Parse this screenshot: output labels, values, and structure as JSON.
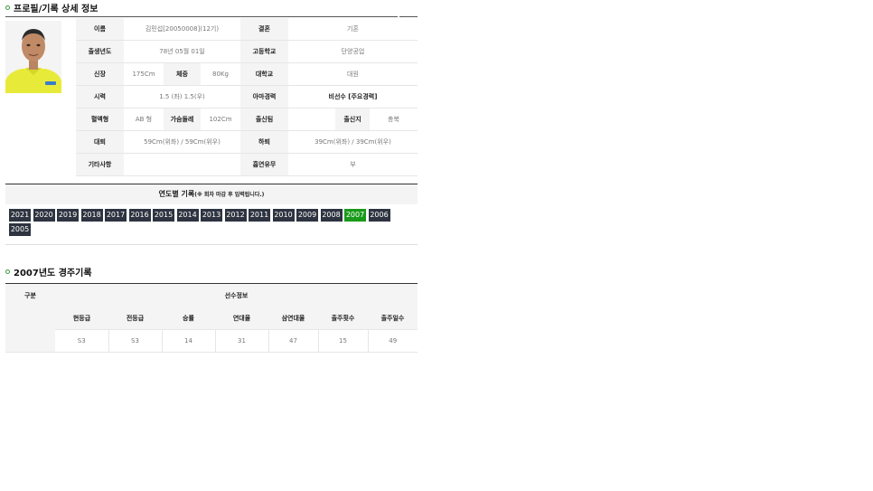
{
  "profile": {
    "title": "프로필/기록 상세 정보",
    "rows": [
      [
        "이름",
        "김민섭[20050008](12기)",
        "결혼",
        "기혼"
      ],
      [
        "출생년도",
        "78년 05월 01일",
        "고등학교",
        "단양공업"
      ],
      [
        "신장",
        "175Cm",
        "체중",
        "80Kg",
        "대학교",
        "대원"
      ],
      [
        "시력",
        "1.5 (좌) 1.5(우)",
        "아마경력",
        "비선수 [주요경력]"
      ],
      [
        "혈액형",
        "AB 형",
        "가슴둘레",
        "102Cm",
        "출신팀",
        "",
        "출신지",
        "충북"
      ],
      [
        "대퇴",
        "59Cm(위좌) / 59Cm(위우)",
        "하퇴",
        "39Cm(위좌) / 39Cm(위우)"
      ],
      [
        "기타사항",
        "",
        "흡연유무",
        "부"
      ]
    ]
  },
  "years": {
    "heading": "연도별 기록",
    "note": "(※ 회차 마감 후 입력됩니다.)",
    "list": [
      "2021",
      "2020",
      "2019",
      "2018",
      "2017",
      "2016",
      "2015",
      "2014",
      "2013",
      "2012",
      "2011",
      "2010",
      "2009",
      "2008",
      "2007",
      "2006",
      "2005"
    ],
    "selected": "2007"
  },
  "record": {
    "title": "2007년도 경주기록",
    "col_group": "구분",
    "group_label": "선수정보",
    "headers": [
      "현등급",
      "전등급",
      "승률",
      "연대율",
      "삼연대율",
      "출주횟수",
      "출주일수"
    ],
    "values": [
      "S3",
      "S3",
      "14",
      "31",
      "47",
      "15",
      "49"
    ]
  },
  "colors": {
    "accent": "#1a9a1a",
    "year_btn": "#2e3440"
  }
}
